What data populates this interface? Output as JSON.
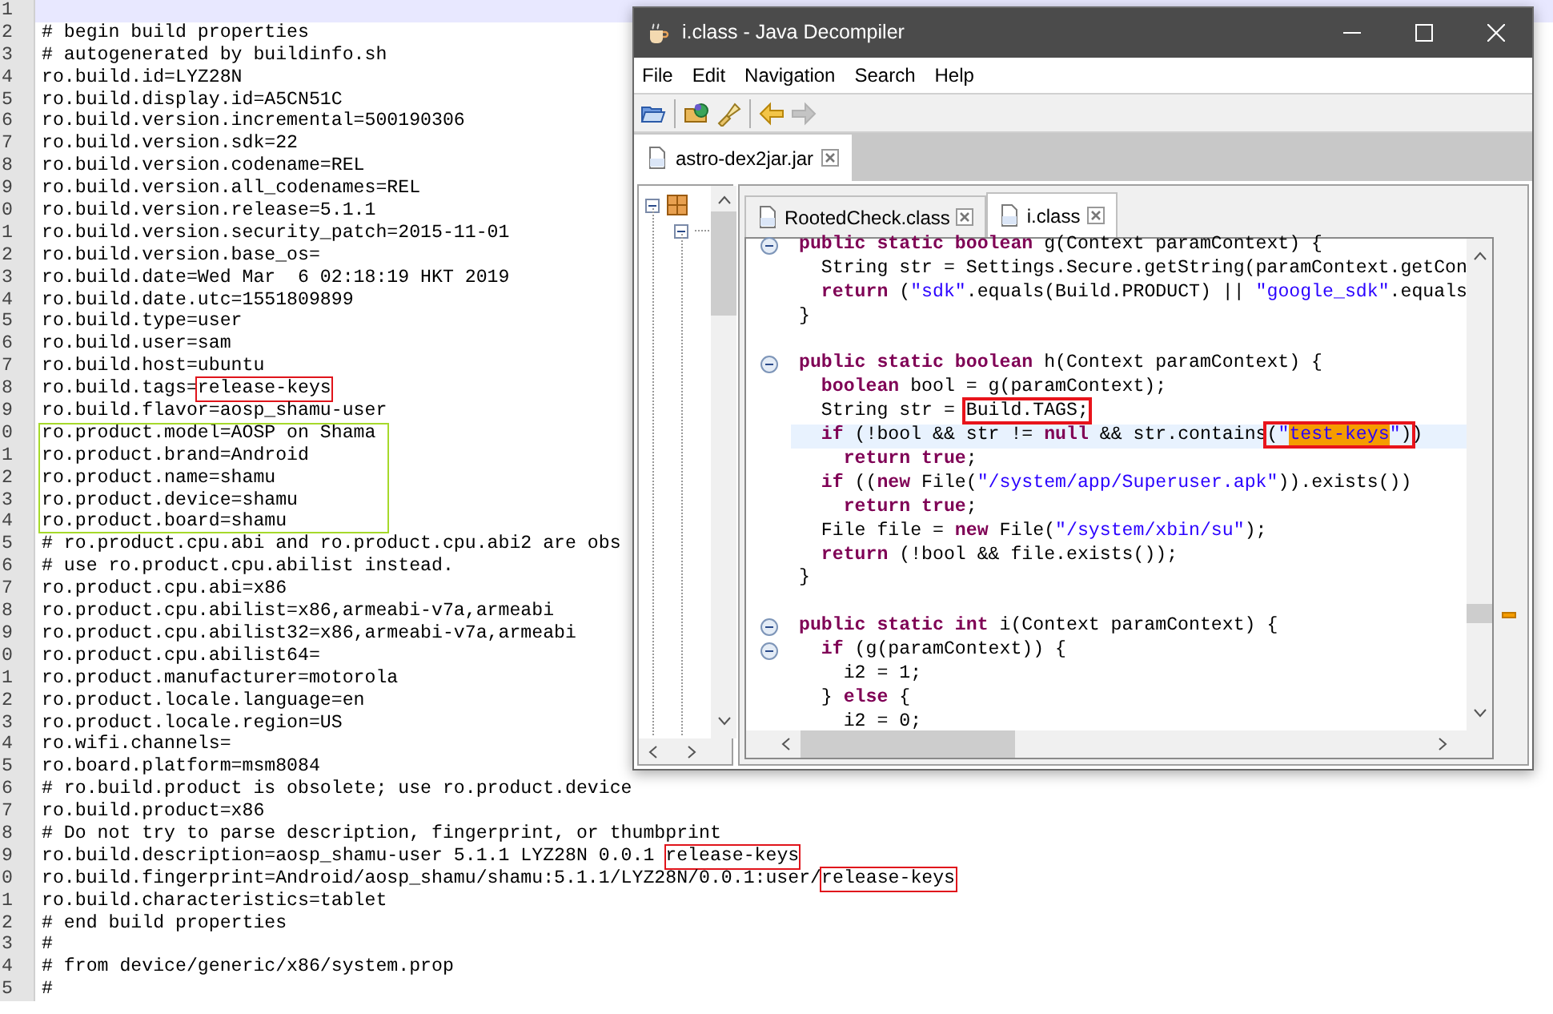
{
  "editor": {
    "lines": [
      {
        "kind": "line",
        "n": "1",
        "current": true
      },
      {
        "kind": "line",
        "n": "2",
        "text": "# begin build properties",
        "current": false
      },
      {
        "kind": "line",
        "n": "3",
        "text": "# autogenerated by buildinfo.sh",
        "current": false
      },
      {
        "kind": "line",
        "n": "4",
        "text": "ro.build.id=LYZ28N",
        "current": false
      },
      {
        "kind": "line",
        "n": "5",
        "text": "ro.build.display.id=A5CN51C",
        "current": false
      },
      {
        "kind": "line",
        "n": "6",
        "text": "ro.build.version.incremental=500190306",
        "current": false
      },
      {
        "kind": "line",
        "n": "7",
        "text": "ro.build.version.sdk=22",
        "current": false
      },
      {
        "kind": "line",
        "n": "8",
        "text": "ro.build.version.codename=REL",
        "current": false
      },
      {
        "kind": "line",
        "n": "9",
        "text": "ro.build.version.all_codenames=REL",
        "current": false
      },
      {
        "kind": "line",
        "n": "0",
        "text": "ro.build.version.release=5.1.1",
        "current": false
      },
      {
        "kind": "line",
        "n": "1",
        "text": "ro.build.version.security_patch=2015-11-01",
        "current": false
      },
      {
        "kind": "line",
        "n": "2",
        "text": "ro.build.version.base_os=",
        "current": false
      },
      {
        "kind": "line",
        "n": "3",
        "text": "ro.build.date=Wed Mar  6 02:18:19 HKT 2019",
        "current": false
      },
      {
        "kind": "line",
        "n": "4",
        "text": "ro.build.date.utc=1551809899",
        "current": false
      },
      {
        "kind": "line",
        "n": "5",
        "text": "ro.build.type=user",
        "current": false
      },
      {
        "kind": "line",
        "n": "6",
        "text": "ro.build.user=sam",
        "current": false
      },
      {
        "kind": "line",
        "n": "7",
        "text": "ro.build.host=ubuntu",
        "current": false
      },
      {
        "kind": "line",
        "n": "8",
        "text": "ro.build.tags=",
        "marked": "release-keys",
        "current": false
      },
      {
        "kind": "line",
        "n": "9",
        "text": "ro.build.flavor=aosp_shamu-user",
        "current": false
      },
      {
        "kind": "block",
        "lines": [
          {
            "kind": "line",
            "n": "0",
            "text": "ro.product.model=AOSP on Shama",
            "current": false
          },
          {
            "kind": "line",
            "n": "1",
            "text": "ro.product.brand=Android",
            "current": false
          },
          {
            "kind": "line",
            "n": "2",
            "text": "ro.product.name=shamu",
            "current": false
          },
          {
            "kind": "line",
            "n": "3",
            "text": "ro.product.device=shamu",
            "current": false
          },
          {
            "kind": "line",
            "n": "4",
            "text": "ro.product.board=shamu",
            "current": false
          }
        ]
      },
      {
        "kind": "line",
        "n": "5",
        "text": "# ro.product.cpu.abi and ro.product.cpu.abi2 are obs",
        "current": false
      },
      {
        "kind": "line",
        "n": "6",
        "text": "# use ro.product.cpu.abilist instead.",
        "current": false
      },
      {
        "kind": "line",
        "n": "7",
        "text": "ro.product.cpu.abi=x86",
        "current": false
      },
      {
        "kind": "line",
        "n": "8",
        "text": "ro.product.cpu.abilist=x86,armeabi-v7a,armeabi",
        "current": false
      },
      {
        "kind": "line",
        "n": "9",
        "text": "ro.product.cpu.abilist32=x86,armeabi-v7a,armeabi",
        "current": false
      },
      {
        "kind": "line",
        "n": "0",
        "text": "ro.product.cpu.abilist64=",
        "current": false
      },
      {
        "kind": "line",
        "n": "1",
        "text": "ro.product.manufacturer=motorola",
        "current": false
      },
      {
        "kind": "line",
        "n": "2",
        "text": "ro.product.locale.language=en",
        "current": false
      },
      {
        "kind": "line",
        "n": "3",
        "text": "ro.product.locale.region=US",
        "current": false
      },
      {
        "kind": "line",
        "n": "4",
        "text": "ro.wifi.channels=",
        "current": false
      },
      {
        "kind": "line",
        "n": "5",
        "text": "ro.board.platform=msm8084",
        "current": false
      },
      {
        "kind": "line",
        "n": "6",
        "text": "# ro.build.product is obsolete; use ro.product.device",
        "current": false
      },
      {
        "kind": "line",
        "n": "7",
        "text": "ro.build.product=x86",
        "current": false
      },
      {
        "kind": "line",
        "n": "8",
        "text": "# Do not try to parse description, fingerprint, or thumbprint",
        "current": false
      },
      {
        "kind": "line",
        "n": "9",
        "text": "ro.build.description=aosp_shamu-user 5.1.1 LYZ28N 0.0.1 ",
        "marked": "release-keys",
        "current": false
      },
      {
        "kind": "line",
        "n": "0",
        "text": "ro.build.fingerprint=Android/aosp_shamu/shamu:5.1.1/LYZ28N/0.0.1:user/",
        "marked": "release-keys",
        "current": false
      },
      {
        "kind": "line",
        "n": "1",
        "text": "ro.build.characteristics=tablet",
        "current": false
      },
      {
        "kind": "line",
        "n": "2",
        "text": "# end build properties",
        "current": false
      },
      {
        "kind": "line",
        "n": "3",
        "text": "#",
        "current": false
      },
      {
        "kind": "line",
        "n": "4",
        "text": "# from device/generic/x86/system.prop",
        "current": false
      },
      {
        "kind": "line",
        "n": "5",
        "text": "#",
        "current": false
      }
    ]
  },
  "decompiler": {
    "title": "i.class - Java Decompiler",
    "menu": [
      "File",
      "Edit",
      "Navigation",
      "Search",
      "Help"
    ],
    "toolbar": [
      {
        "kind": "open",
        "disabled": false
      },
      {
        "kind": "open-type",
        "disabled": false
      },
      {
        "kind": "search",
        "disabled": false
      },
      {
        "kind": "back",
        "disabled": false
      },
      {
        "kind": "forward",
        "disabled": true
      }
    ],
    "file_tabs": [
      {
        "label": "astro-dex2jar.jar",
        "selected": true
      }
    ],
    "tree": [
      {
        "kind": "package",
        "expanded": true,
        "children": [
          {
            "kind": "node",
            "expanded": true
          }
        ]
      }
    ],
    "class_tabs": [
      {
        "label": "RootedCheck.class",
        "selected": false
      },
      {
        "label": "i.class",
        "selected": true
      }
    ],
    "code": [
      {
        "fold": true,
        "current": false,
        "tokens": [
          {
            "kind": "keyword",
            "t": "public static boolean"
          },
          {
            "kind": "plain",
            "t": " g(Context paramContext) {"
          }
        ]
      },
      {
        "fold": false,
        "current": false,
        "tokens": [
          {
            "kind": "plain",
            "t": "  String str = Settings.Secure.getString(paramContext.getCon"
          }
        ]
      },
      {
        "fold": false,
        "current": false,
        "tokens": [
          {
            "kind": "keyword",
            "t": "  return"
          },
          {
            "kind": "plain",
            "t": " ("
          },
          {
            "kind": "string",
            "t": "\"sdk\""
          },
          {
            "kind": "plain",
            "t": ".equals(Build.PRODUCT) || "
          },
          {
            "kind": "string",
            "t": "\"google_sdk\""
          },
          {
            "kind": "plain",
            "t": ".equals"
          }
        ]
      },
      {
        "fold": false,
        "current": false,
        "tokens": [
          {
            "kind": "plain",
            "t": "}"
          }
        ]
      },
      {
        "fold": false,
        "current": false
      },
      {
        "fold": true,
        "current": false,
        "tokens": [
          {
            "kind": "keyword",
            "t": "public static boolean"
          },
          {
            "kind": "plain",
            "t": " h(Context paramContext) {"
          }
        ]
      },
      {
        "fold": false,
        "current": false,
        "tokens": [
          {
            "kind": "keyword",
            "t": "  boolean"
          },
          {
            "kind": "plain",
            "t": " bool = g(paramContext);"
          }
        ]
      },
      {
        "fold": false,
        "current": false,
        "tokens": [
          {
            "kind": "plain",
            "t": "  String str = "
          },
          {
            "kind": "box",
            "tokens": [
              {
                "kind": "plain",
                "t": "Build.TAGS;"
              }
            ]
          }
        ]
      },
      {
        "fold": false,
        "current": true,
        "tokens": [
          {
            "kind": "keyword",
            "t": "  if"
          },
          {
            "kind": "plain",
            "t": " (!bool && str != "
          },
          {
            "kind": "keyword",
            "t": "null"
          },
          {
            "kind": "plain",
            "t": " && str.contains"
          },
          {
            "kind": "box",
            "tokens": [
              {
                "kind": "plain",
                "t": "("
              },
              {
                "kind": "string",
                "t": "\""
              },
              {
                "kind": "match",
                "t": "test-keys"
              },
              {
                "kind": "string",
                "t": "\""
              },
              {
                "kind": "plain",
                "t": ")"
              }
            ]
          },
          {
            "kind": "plain",
            "t": ")"
          }
        ]
      },
      {
        "fold": false,
        "current": false,
        "tokens": [
          {
            "kind": "keyword",
            "t": "    return true"
          },
          {
            "kind": "plain",
            "t": ";"
          }
        ]
      },
      {
        "fold": false,
        "current": false,
        "tokens": [
          {
            "kind": "keyword",
            "t": "  if"
          },
          {
            "kind": "plain",
            "t": " (("
          },
          {
            "kind": "keyword",
            "t": "new"
          },
          {
            "kind": "plain",
            "t": " File("
          },
          {
            "kind": "string",
            "t": "\"/system/app/Superuser.apk\""
          },
          {
            "kind": "plain",
            "t": ")).exists())"
          }
        ]
      },
      {
        "fold": false,
        "current": false,
        "tokens": [
          {
            "kind": "keyword",
            "t": "    return true"
          },
          {
            "kind": "plain",
            "t": ";"
          }
        ]
      },
      {
        "fold": false,
        "current": false,
        "tokens": [
          {
            "kind": "plain",
            "t": "  File file = "
          },
          {
            "kind": "keyword",
            "t": "new"
          },
          {
            "kind": "plain",
            "t": " File("
          },
          {
            "kind": "string",
            "t": "\"/system/xbin/su\""
          },
          {
            "kind": "plain",
            "t": ");"
          }
        ]
      },
      {
        "fold": false,
        "current": false,
        "tokens": [
          {
            "kind": "keyword",
            "t": "  return"
          },
          {
            "kind": "plain",
            "t": " (!bool && file.exists());"
          }
        ]
      },
      {
        "fold": false,
        "current": false,
        "tokens": [
          {
            "kind": "plain",
            "t": "}"
          }
        ]
      },
      {
        "fold": false,
        "current": false
      },
      {
        "fold": true,
        "current": false,
        "tokens": [
          {
            "kind": "keyword",
            "t": "public static int"
          },
          {
            "kind": "plain",
            "t": " i(Context paramContext) {"
          }
        ]
      },
      {
        "fold": true,
        "current": false,
        "tokens": [
          {
            "kind": "keyword",
            "t": "  if"
          },
          {
            "kind": "plain",
            "t": " (g(paramContext)) {"
          }
        ]
      },
      {
        "fold": false,
        "current": false,
        "tokens": [
          {
            "kind": "plain",
            "t": "    i2 = 1;"
          }
        ]
      },
      {
        "fold": false,
        "current": false,
        "tokens": [
          {
            "kind": "plain",
            "t": "  } "
          },
          {
            "kind": "keyword",
            "t": "else"
          },
          {
            "kind": "plain",
            "t": " {"
          }
        ]
      },
      {
        "fold": false,
        "current": false,
        "tokens": [
          {
            "kind": "plain",
            "t": "    i2 = 0;"
          }
        ]
      }
    ]
  }
}
